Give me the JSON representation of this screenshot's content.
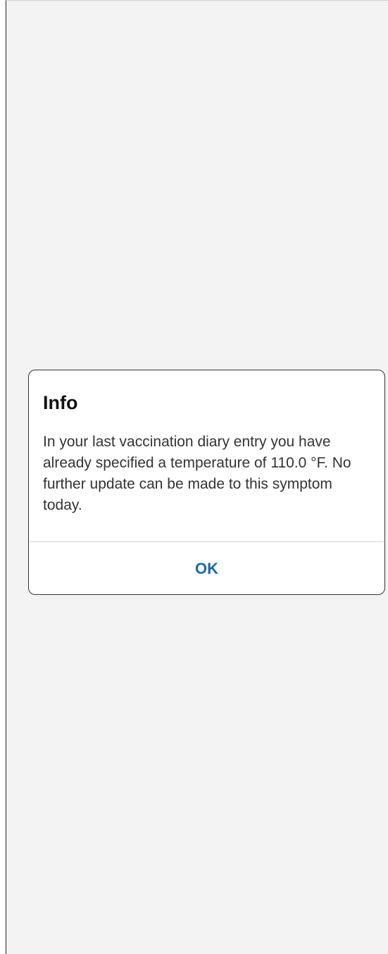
{
  "dialog": {
    "title": "Info",
    "message": "In your last vaccination diary entry you have already specified a temperature of 110.0 °F. No further update can be made to this symptom today.",
    "ok_label": "OK"
  },
  "colors": {
    "background": "#f3f3f3",
    "dialog_background": "#ffffff",
    "accent": "#1a6aa8",
    "text": "#333333"
  }
}
